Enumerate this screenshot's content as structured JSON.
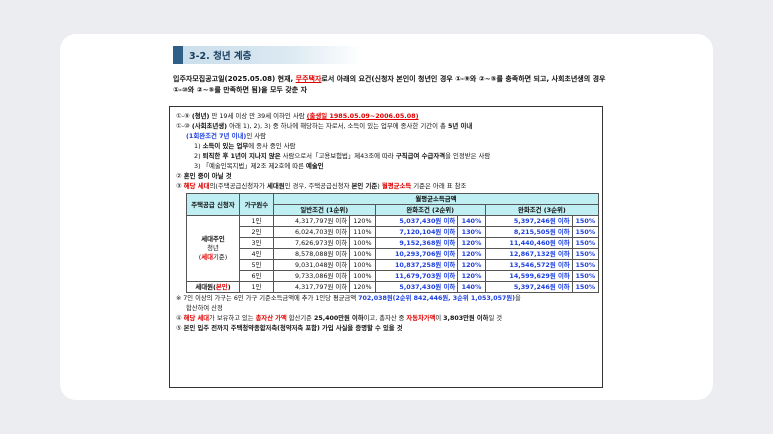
{
  "section_title": "3-2. 청년 계층",
  "intro": {
    "p1": "입주자모집공고일(2025.05.08) 현재, ",
    "p2": "무주택자",
    "p3": "로서 아래의 요건(신청자 본인이 청년인 경우 ①-⑨와 ②~⑤를 충족하면 되고, 사회초년생의 경우 ①-⑩와 ②~⑤를 만족하면 됨)을 모두 갖춘 자"
  },
  "cond1a": {
    "num": "①-⑨",
    "bold": "(청년)",
    "text": " 만 19세 이상 만 39세 이하인 사람",
    "red": "(출생일 1985.05.09~2006.05.08)"
  },
  "cond1b": {
    "num": "①-⑩",
    "bold": "(사회초년생)",
    "text1": " 아래 1), 2), 3) 중 하나에 해당하는 자로서, 소득이 있는 업무에 종사한 기간이 총 ",
    "bold2": "5년 이내",
    "sub_blue": "(1회완조건 7년 이내)",
    "sub_text": "인 사람",
    "item1_bold": "소득이 있는 업무",
    "item1_text": "에 종사 중인 사람",
    "item2_bold": "퇴직한 후 1년이 지나지 않은",
    "item2_text1": " 사람으로서「고용보험법」제43조에 따라 ",
    "item2_bold2": "구직급여 수급자격",
    "item2_text2": "을 인정받은 사람",
    "item3_text": "「예술인복지법」제2조 제2호에 따른 ",
    "item3_bold": "예술인"
  },
  "cond2": {
    "num": "②",
    "text": "혼인 중이 아닐 것"
  },
  "cond3": {
    "num": "③",
    "red1": "해당 세대",
    "text1": "의(주택공급신청자가 ",
    "bold1": "세대원",
    "text2": "인 경우, 주택공급신청자 ",
    "bold2": "본인 기준",
    "text3": ") ",
    "red2": "월평균소득",
    "text4": " 기준은 아래 표 참조"
  },
  "table": {
    "h_applicant": "주택공급 신청자",
    "h_members": "가구원수",
    "h_income": "월평균소득금액",
    "h_general": "일반조건 (1순위)",
    "h_relaxed2": "완화조건 (2순위)",
    "h_relaxed3": "완화조건 (3순위)",
    "group_head1": "세대주인",
    "group_head2": "청년",
    "group_head3_pre": "(",
    "group_head3_red": "세대",
    "group_head3_post": "기준)",
    "rows": [
      {
        "members": "1인",
        "general": "4,317,797원 이하",
        "gp": "120%",
        "r2": "5,037,430원 이하",
        "r2p": "140%",
        "r3": "5,397,246원 이하",
        "r3p": "150%"
      },
      {
        "members": "2인",
        "general": "6,024,703원 이하",
        "gp": "110%",
        "r2": "7,120,104원 이하",
        "r2p": "130%",
        "r3": "8,215,505원 이하",
        "r3p": "150%"
      },
      {
        "members": "3인",
        "general": "7,626,973원 이하",
        "gp": "100%",
        "r2": "9,152,368원 이하",
        "r2p": "120%",
        "r3": "11,440,460원 이하",
        "r3p": "150%"
      },
      {
        "members": "4인",
        "general": "8,578,088원 이하",
        "gp": "100%",
        "r2": "10,293,706원 이하",
        "r2p": "120%",
        "r3": "12,867,132원 이하",
        "r3p": "150%"
      },
      {
        "members": "5인",
        "general": "9,031,048원 이하",
        "gp": "100%",
        "r2": "10,837,258원 이하",
        "r2p": "120%",
        "r3": "13,546,572원 이하",
        "r3p": "150%"
      },
      {
        "members": "6인",
        "general": "9,733,086원 이하",
        "gp": "100%",
        "r2": "11,679,703원 이하",
        "r2p": "120%",
        "r3": "14,599,629원 이하",
        "r3p": "150%"
      }
    ],
    "member_row": {
      "applicant_pre": "세대원(",
      "applicant_red": "본인",
      "applicant_post": ")",
      "members": "1인",
      "general": "4,317,797원 이하",
      "gp": "120%",
      "r2": "5,037,430원 이하",
      "r2p": "140%",
      "r3": "5,397,246원 이하",
      "r3p": "150%"
    }
  },
  "note": {
    "mark": "※",
    "text1": " 7인 이상의 가구는 6인 가구 기준소득금액에 추가 1인당 평균금액 ",
    "blue": "702,038원(2순위 842,446원, 3순위 1,053,057원)",
    "text2": "을",
    "line2": "합산하여 산정"
  },
  "cond4": {
    "num": "④",
    "red1": "해당 세대",
    "text1": "가 보유하고 있는 ",
    "red2": "총자산 가액",
    "text2": " 합산기준 ",
    "bold1": "25,400만원 이하",
    "text3": "이고, 총자산 중 ",
    "red3": "자동차가액",
    "text4": "이 ",
    "bold2": "3,803만원 이하",
    "text5": "일 것"
  },
  "cond5": {
    "num": "⑤",
    "text": "본인 입주 전까지 주택청약종합저축(청약저축 포함) 가입 사실을 증명할 수 있을 것"
  }
}
